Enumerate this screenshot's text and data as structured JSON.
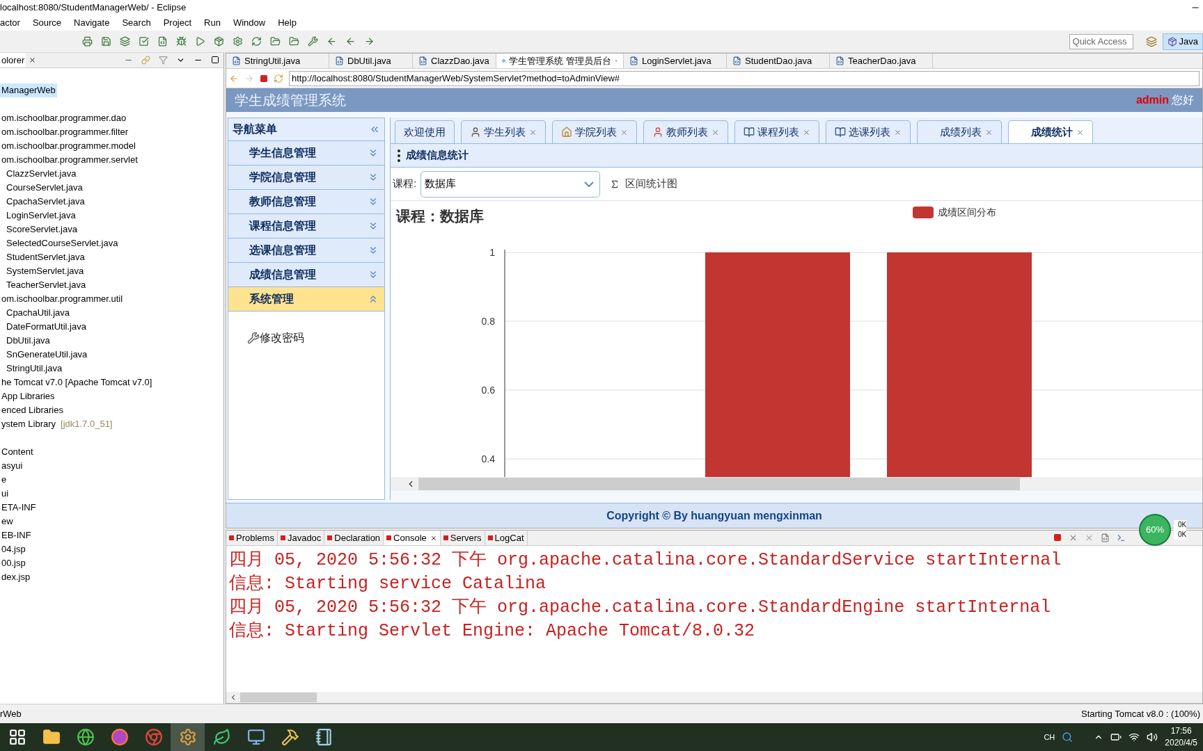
{
  "window": {
    "title": "localhost:8080/StudentManagerWeb/ - Eclipse"
  },
  "menu": [
    "actor",
    "Source",
    "Navigate",
    "Search",
    "Project",
    "Run",
    "Window",
    "Help"
  ],
  "toolbar": {
    "quick_access": {
      "placeholder": "Quick Access"
    },
    "perspective": {
      "label": "Java",
      "selected": true
    }
  },
  "explorer": {
    "tab": "olorer",
    "sections": [
      {
        "items": [
          {
            "label": "ManagerWeb",
            "selected": true
          }
        ]
      },
      {
        "items": [
          {
            "label": "om.ischoolbar.programmer.dao",
            "selected": false
          },
          {
            "label": "om.ischoolbar.programmer.filter",
            "selected": false
          },
          {
            "label": "om.ischoolbar.programmer.model",
            "selected": false
          },
          {
            "label": "om.ischoolbar.programmer.servlet",
            "selected": false,
            "children": [
              {
                "label": "ClazzServlet.java",
                "selected": false
              },
              {
                "label": "CourseServlet.java",
                "selected": false
              },
              {
                "label": "CpachaServlet.java",
                "selected": false
              },
              {
                "label": "LoginServlet.java",
                "selected": false
              },
              {
                "label": "ScoreServlet.java",
                "selected": false
              },
              {
                "label": "SelectedCourseServlet.java",
                "selected": false
              },
              {
                "label": "StudentServlet.java",
                "selected": false
              },
              {
                "label": "SystemServlet.java",
                "selected": false
              },
              {
                "label": "TeacherServlet.java",
                "selected": false
              }
            ]
          },
          {
            "label": "om.ischoolbar.programmer.util",
            "selected": false,
            "children": [
              {
                "label": "CpachaUtil.java",
                "selected": false
              },
              {
                "label": "DateFormatUtil.java",
                "selected": false
              },
              {
                "label": "DbUtil.java",
                "selected": false
              },
              {
                "label": "SnGenerateUtil.java",
                "selected": false
              },
              {
                "label": "StringUtil.java",
                "selected": false
              }
            ]
          },
          {
            "label": "he Tomcat v7.0 [Apache Tomcat v7.0]",
            "selected": false
          },
          {
            "label": "App Libraries",
            "selected": false
          },
          {
            "label": "enced Libraries",
            "selected": false
          },
          {
            "label": "ystem Library",
            "note": "[jdk1.7.0_51]",
            "selected": false
          }
        ]
      },
      {
        "items": [
          {
            "label": "Content",
            "selected": false
          },
          {
            "label": "asyui",
            "selected": false
          },
          {
            "label": "e",
            "selected": false
          },
          {
            "label": "ui",
            "selected": false
          },
          {
            "label": "ETA-INF",
            "selected": false
          },
          {
            "label": "ew",
            "selected": false
          },
          {
            "label": "EB-INF",
            "selected": false
          },
          {
            "label": "04.jsp",
            "selected": false
          },
          {
            "label": "00.jsp",
            "selected": false
          },
          {
            "label": "dex.jsp",
            "selected": false
          }
        ]
      }
    ]
  },
  "editor_tabs": [
    {
      "label": "StringUtil.java",
      "kind": "java",
      "selected": false
    },
    {
      "label": "DbUtil.java",
      "kind": "java",
      "selected": false
    },
    {
      "label": "ClazzDao.java",
      "kind": "java",
      "selected": false
    },
    {
      "label": "学生管理系统 管理员后台",
      "kind": "web",
      "selected": true
    },
    {
      "label": "LoginServlet.java",
      "kind": "java",
      "selected": false
    },
    {
      "label": "StudentDao.java",
      "kind": "java",
      "selected": false
    },
    {
      "label": "TeacherDao.java",
      "kind": "java",
      "selected": false
    }
  ],
  "browser": {
    "url": "http://localhost:8080/StudentManagerWeb/SystemServlet?method=toAdminView#"
  },
  "webpage": {
    "title": "学生成绩管理系统",
    "user": "admin",
    "greeting": "您好",
    "nav": {
      "title": "导航菜单",
      "groups": [
        {
          "label": "学生信息管理",
          "expanded": false
        },
        {
          "label": "学院信息管理",
          "expanded": false
        },
        {
          "label": "教师信息管理",
          "expanded": false
        },
        {
          "label": "课程信息管理",
          "expanded": false
        },
        {
          "label": "选课信息管理",
          "expanded": false
        },
        {
          "label": "成绩信息管理",
          "expanded": false
        },
        {
          "label": "系统管理",
          "expanded": true,
          "items": [
            "修改密码"
          ]
        }
      ]
    },
    "tabs": [
      {
        "label": "欢迎使用",
        "kind": "plain",
        "closable": false,
        "selected": false
      },
      {
        "label": "学生列表",
        "kind": "student",
        "closable": true,
        "selected": false
      },
      {
        "label": "学院列表",
        "kind": "house",
        "closable": true,
        "selected": false
      },
      {
        "label": "教师列表",
        "kind": "teacher",
        "closable": true,
        "selected": false
      },
      {
        "label": "课程列表",
        "kind": "book",
        "closable": true,
        "selected": false
      },
      {
        "label": "选课列表",
        "kind": "book",
        "closable": true,
        "selected": false
      },
      {
        "label": "成绩列表",
        "kind": "blank",
        "closable": true,
        "selected": false
      },
      {
        "label": "成绩统计",
        "kind": "blank",
        "closable": true,
        "selected": true
      }
    ],
    "panel": {
      "title": "成绩信息统计",
      "course_label": "课程:",
      "course_value": "数据库",
      "button": "区间统计图",
      "chart_data": {
        "type": "bar",
        "title": "课程：数据库",
        "ylim": [
          0,
          1
        ],
        "grid": true,
        "yticks": [
          0.4,
          0.6,
          0.8,
          1
        ],
        "series": [
          {
            "name": "成绩区间分布",
            "color": "#c23531",
            "values": [
              1,
              1
            ]
          }
        ]
      }
    },
    "footer": "Copyright © By huangyuan mengxinman"
  },
  "console": {
    "tabs": [
      {
        "label": "Problems",
        "selected": false
      },
      {
        "label": "Javadoc",
        "selected": false
      },
      {
        "label": "Declaration",
        "selected": false
      },
      {
        "label": "Console",
        "selected": true
      },
      {
        "label": "Servers",
        "selected": false
      },
      {
        "label": "LogCat",
        "selected": false
      }
    ],
    "lines": [
      "四月 05, 2020 5:56:32 下午 org.apache.catalina.core.StandardService startInternal",
      "信息: Starting service Catalina",
      "四月 05, 2020 5:56:32 下午 org.apache.catalina.core.StandardEngine startInternal",
      "信息: Starting Servlet Engine: Apache Tomcat/8.0.32"
    ]
  },
  "monitor": {
    "percent": "60%",
    "up": "0K",
    "down": "0K"
  },
  "status_bar": {
    "left": "rWeb",
    "right": "Starting Tomcat v8.0 : (100%)"
  },
  "taskbar": {
    "apps": [
      {
        "kind": "taskview",
        "active": false
      },
      {
        "kind": "folder",
        "active": false
      },
      {
        "kind": "ie",
        "active": false
      },
      {
        "kind": "firefox",
        "active": false
      },
      {
        "kind": "chrome",
        "active": false
      },
      {
        "kind": "gear",
        "active": true
      },
      {
        "kind": "leaf",
        "active": false
      },
      {
        "kind": "computer",
        "active": false
      },
      {
        "kind": "tools",
        "active": false
      },
      {
        "kind": "notepad",
        "active": false
      }
    ],
    "lang": "CH",
    "time": "17:56",
    "date": "2020/4/5"
  }
}
